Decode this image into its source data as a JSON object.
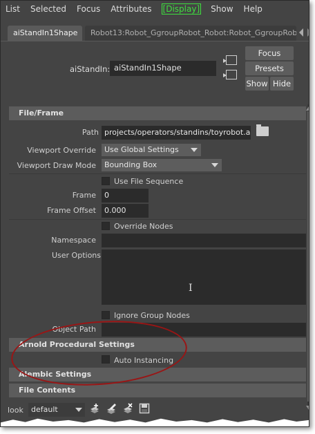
{
  "menu": [
    "List",
    "Selected",
    "Focus",
    "Attributes",
    "[Display]",
    "Show",
    "Help"
  ],
  "active_menu_color": "#3ee03e",
  "tabs": [
    "aiStandIn1Shape",
    "Robot13:Robot_GgroupRobot_Robot:Robot_GgroupRob"
  ],
  "node": {
    "label": "aiStandIn:",
    "value": "aiStandIn1Shape"
  },
  "buttons": {
    "focus": "Focus",
    "presets": "Presets",
    "show": "Show",
    "hide": "Hide"
  },
  "sections": {
    "file_frame": "File/Frame",
    "arnold": "Arnold Procedural Settings",
    "alembic": "Alembic Settings",
    "file_contents": "File Contents"
  },
  "fields": {
    "path_label": "Path",
    "path_value": "projects/operators/standins/toyrobot.ass",
    "viewport_override_label": "Viewport Override",
    "viewport_override_value": "Use Global Settings",
    "viewport_draw_label": "Viewport Draw Mode",
    "viewport_draw_value": "Bounding Box",
    "use_file_sequence": "Use File Sequence",
    "frame_label": "Frame",
    "frame_value": "0",
    "frame_offset_label": "Frame Offset",
    "frame_offset_value": "0.000",
    "override_nodes": "Override Nodes",
    "namespace_label": "Namespace",
    "namespace_value": "",
    "user_options_label": "User Options",
    "user_options_value": "",
    "ignore_group_nodes": "Ignore Group Nodes",
    "object_path_label": "Object Path",
    "object_path_value": "",
    "auto_instancing": "Auto Instancing"
  },
  "look": {
    "label": "look",
    "value": "default"
  },
  "icons": [
    "add-operator-icon",
    "edit-operator-icon",
    "delete-operator-icon",
    "save-icon"
  ],
  "highlight_color": "#9a1515"
}
